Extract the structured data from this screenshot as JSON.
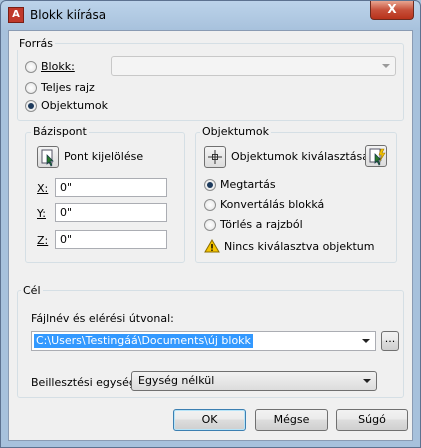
{
  "window": {
    "title": "Blokk kiírása",
    "close_glyph": "X"
  },
  "source": {
    "group_label": "Forrás",
    "block": {
      "label": "Blokk:",
      "selected": false
    },
    "whole_drawing": {
      "label": "Teljes rajz",
      "selected": false
    },
    "objects": {
      "label": "Objektumok",
      "selected": true
    }
  },
  "base_point": {
    "group_label": "Bázispont",
    "pick_button": "Pont kijelölése",
    "x_label": "X:",
    "x_value": "0\"",
    "y_label": "Y:",
    "y_value": "0\"",
    "z_label": "Z:",
    "z_value": "0\""
  },
  "objects": {
    "group_label": "Objektumok",
    "select_button": "Objektumok kiválasztása",
    "options": [
      {
        "label": "Megtartás",
        "selected": true
      },
      {
        "label": "Konvertálás blokká",
        "selected": false
      },
      {
        "label": "Törlés a rajzból",
        "selected": false
      }
    ],
    "warning": "Nincs kiválasztva objektum"
  },
  "destination": {
    "group_label": "Cél",
    "path_label": "Fájlnév és elérési útvonal:",
    "path_value": "C:\\Users\\Testingáá\\Documents\\új blokk",
    "browse_label": "...",
    "units_label": "Beillesztési egység:",
    "units_value": "Egység nélkül"
  },
  "buttons": {
    "ok": "OK",
    "cancel": "Mégse",
    "help": "Súgó"
  },
  "colors": {
    "selection": "#3399ff",
    "warning": "#f5c400"
  }
}
